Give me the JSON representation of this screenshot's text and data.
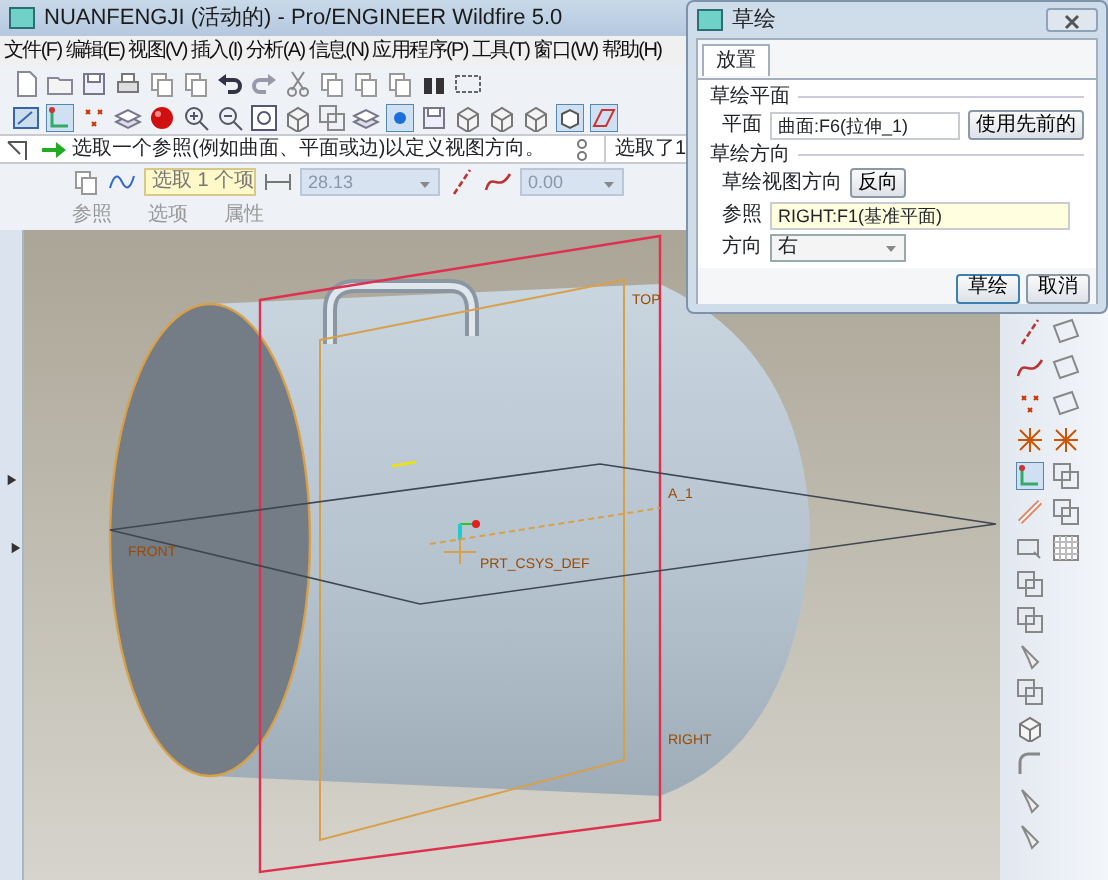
{
  "window": {
    "title": "NUANFENGJI (活动的) - Pro/ENGINEER Wildfire 5.0"
  },
  "menu": [
    "文件(F)",
    "编辑(E)",
    "视图(V)",
    "插入(I)",
    "分析(A)",
    "信息(N)",
    "应用程序(P)",
    "工具(T)",
    "窗口(W)",
    "帮助(H)"
  ],
  "message": {
    "text": "选取一个参照(例如曲面、平面或边)以定义视图方向。",
    "selection_status": "选取了1"
  },
  "dashboard": {
    "collector": "选取 1 个项",
    "depth": "28.13",
    "angle": "0.00",
    "tabs": [
      "参照",
      "选项",
      "属性"
    ]
  },
  "canvas": {
    "datum_labels": [
      "FRONT",
      "PRT_CSYS_DEF",
      "A_1",
      "RIGHT",
      "TOP"
    ]
  },
  "dialog": {
    "title": "草绘",
    "tabs": [
      {
        "label": "放置",
        "selected": true
      }
    ],
    "plane_section": "草绘平面",
    "plane_label": "平面",
    "plane_value": "曲面:F6(拉伸_1)",
    "use_previous_button": "使用先前的",
    "orientation_section": "草绘方向",
    "view_direction_label": "草绘视图方向",
    "flip_button": "反向",
    "reference_label": "参照",
    "reference_value": "RIGHT:F1(基准平面)",
    "direction_label": "方向",
    "direction_value": "右",
    "buttons": [
      "草绘",
      "取消"
    ]
  }
}
